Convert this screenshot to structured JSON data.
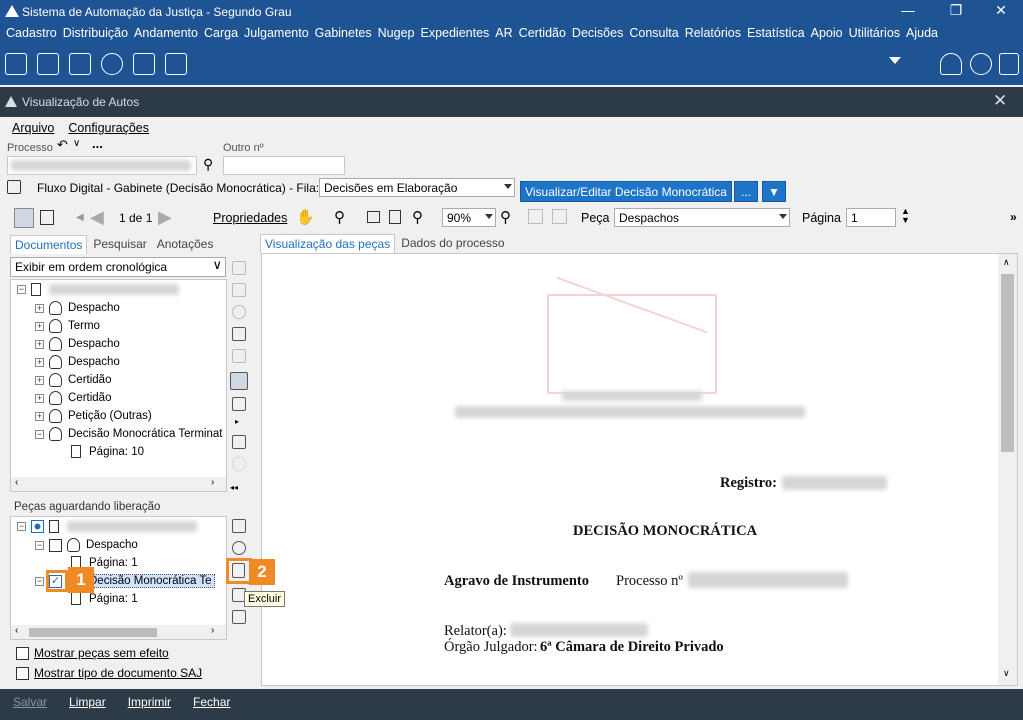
{
  "window": {
    "title": "Sistema de Automação da Justiça - Segundo Grau"
  },
  "menu": [
    "Cadastro",
    "Distribuição",
    "Andamento",
    "Carga",
    "Julgamento",
    "Gabinetes",
    "Nugep",
    "Expedientes",
    "AR",
    "Certidão",
    "Decisões",
    "Consulta",
    "Relatórios",
    "Estatística",
    "Apoio",
    "Utilitários",
    "Ajuda"
  ],
  "subwindow": {
    "title": "Visualização de Autos"
  },
  "submenu": {
    "file": "Arquivo",
    "config": "Configurações"
  },
  "process": {
    "label": "Processo",
    "other_label": "Outro nº"
  },
  "flow": {
    "text": "Fluxo Digital - Gabinete (Decisão Monocrática) - Fila:",
    "queue": "Decisões em Elaboração",
    "action": "Visualizar/Editar Decisão Monocrática",
    "more": "..."
  },
  "toolbar": {
    "page_count": "1 de 1",
    "properties": "Propriedades",
    "zoom": "90%",
    "peca_label": "Peça",
    "peca_value": "Despachos",
    "pagina_label": "Página",
    "pagina_value": "1"
  },
  "left_tabs": [
    "Documentos",
    "Pesquisar",
    "Anotações"
  ],
  "order": "Exibir em ordem cronológica",
  "doc_tree": [
    "Despacho",
    "Termo",
    "Despacho",
    "Despacho",
    "Certidão",
    "Certidão",
    "Petição (Outras)",
    "Decisão Monocrática Terminat"
  ],
  "doc_tree_page": "Página: 10",
  "pending": {
    "title": "Peças aguardando liberação",
    "item1": "Despacho",
    "item1_page": "Página: 1",
    "item2": "Decisão Monocrática Te",
    "item2_page": "Página: 1"
  },
  "options": {
    "no_effect": "Mostrar peças sem efeito",
    "doc_type": "Mostrar tipo de documento SAJ"
  },
  "right_tabs": [
    "Visualização das peças",
    "Dados do processo"
  ],
  "tooltip": "Excluir",
  "badges": [
    "1",
    "2"
  ],
  "doc": {
    "registro": "Registro:",
    "title": "DECISÃO MONOCRÁTICA",
    "agravo": "Agravo de Instrumento",
    "processo": "Processo nº",
    "relator": "Relator(a):",
    "orgao_label": "Órgão Julgador:",
    "orgao_value": "6ª Câmara de Direito Privado"
  },
  "status": [
    "Salvar",
    "Limpar",
    "Imprimir",
    "Fechar"
  ]
}
